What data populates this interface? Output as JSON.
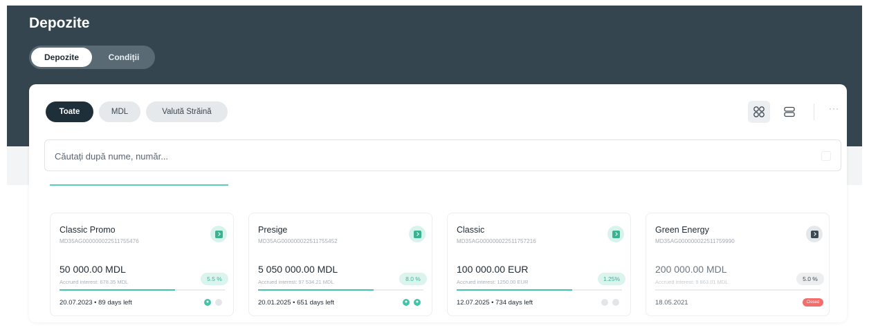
{
  "page": {
    "title": "Depozite"
  },
  "segmented": {
    "items": [
      {
        "label": "Depozite",
        "active": true
      },
      {
        "label": "Condiții",
        "active": false
      }
    ]
  },
  "filters": [
    {
      "label": "Toate",
      "active": true
    },
    {
      "label": "MDL",
      "active": false
    },
    {
      "label": "Valută Străină",
      "active": false
    }
  ],
  "view_toggle": {
    "active": "grid",
    "icons": [
      "grid-view-icon",
      "list-view-icon",
      "more-icon"
    ],
    "more_label": "···"
  },
  "search": {
    "placeholder": "Căutați după nume, număr..."
  },
  "colors": {
    "header_bg": "#354550",
    "accent": "#45c3a8",
    "active_filter_bg": "#1f2f3a",
    "closed_badge": "#f46c6c"
  },
  "deposits": [
    {
      "name": "Classic Promo",
      "iban": "MD35AG000000022511755476",
      "amount": "50 000.00 MDL",
      "interest": "Accrued interest: 678.35 MDL",
      "rate": "5.5 %",
      "progress": 0.7,
      "date": "20.07.2023 • 89 days left",
      "status": "active",
      "icon": "deposit-icon"
    },
    {
      "name": "Presige",
      "iban": "MD35AG000000022511755452",
      "amount": "5 050 000.00 MDL",
      "interest": "Accrued interest: 97 534.21 MDL",
      "rate": "8.0 %",
      "progress": 0.7,
      "date": "20.01.2025 • 651 days left",
      "status": "active",
      "icon": "deposit-icon"
    },
    {
      "name": "Classic",
      "iban": "MD35AG000000022511757216",
      "amount": "100 000.00 EUR",
      "interest": "Accrued interest: 1250.00 EUR",
      "rate": "1.25%",
      "progress": 0.7,
      "date": "12.07.2025 • 734 days left",
      "status": "active",
      "icon": "deposit-icon"
    },
    {
      "name": "Green Energy",
      "iban": "MD35AG000000022511759990",
      "amount": "200 000.00 MDL",
      "interest": "Accrued interest: 9 863.01 MDL",
      "rate": "5.0 %",
      "progress": 0,
      "date": "18.05.2021",
      "status": "closed",
      "status_label": "Closed",
      "icon": "deposit-icon"
    }
  ]
}
